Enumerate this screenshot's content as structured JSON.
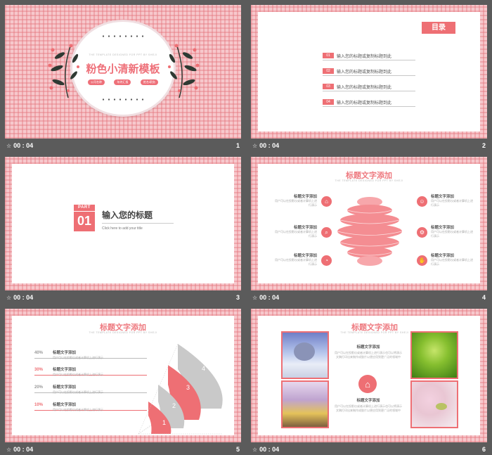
{
  "slides": [
    {
      "index": 1,
      "time": "00 : 04",
      "num": "1",
      "subtitle": "THE TEMPLATE DESIGNED FOR PPT BY SHEJI",
      "title": "粉色小清新模板",
      "tags": [
        "公司名称",
        "年终汇报",
        "姓名/职务"
      ]
    },
    {
      "index": 2,
      "time": "00 : 04",
      "num": "2",
      "heading": "目录",
      "items": [
        {
          "n": "01",
          "text": "输入您的标题或复制标题到此"
        },
        {
          "n": "02",
          "text": "输入您的标题或复制标题到此"
        },
        {
          "n": "03",
          "text": "输入您的标题或复制标题到此"
        },
        {
          "n": "04",
          "text": "输入您的标题或复制标题到此"
        }
      ]
    },
    {
      "index": 3,
      "time": "00 : 04",
      "num": "3",
      "part": "PART",
      "part_num": "01",
      "title": "输入您的标题",
      "subtitle": "Click here to add your title"
    },
    {
      "index": 4,
      "time": "00 : 04",
      "num": "4",
      "title": "标题文字添加",
      "subtitle": "THE TEMPLATE DESIGNED FOR PPT BY SHEJI",
      "blocks": [
        {
          "label": "标题文字添加",
          "desc": "用户可以在投影仪或者计算机上进行演示"
        },
        {
          "label": "标题文字添加",
          "desc": "用户可以在投影仪或者计算机上进行演示"
        },
        {
          "label": "标题文字添加",
          "desc": "用户可以在投影仪或者计算机上进行演示"
        },
        {
          "label": "标题文字添加",
          "desc": "用户可以在投影仪或者计算机上进行演示"
        },
        {
          "label": "标题文字添加",
          "desc": "用户可以在投影仪或者计算机上进行演示"
        },
        {
          "label": "标题文字添加",
          "desc": "用户可以在投影仪或者计算机上进行演示"
        }
      ],
      "icons": [
        "bank-icon",
        "search-icon",
        "pie-icon",
        "user-icon",
        "gear-icon",
        "hand-icon"
      ]
    },
    {
      "index": 5,
      "time": "00 : 04",
      "num": "5",
      "title": "标题文字添加",
      "subtitle": "THE TEMPLATE DESIGNED FOR PPT BY SHEJI",
      "rows": [
        {
          "pct": "40%",
          "label": "标题文字添加",
          "desc": "用户可以在投影仪或者计算机上进行演示"
        },
        {
          "pct": "30%",
          "label": "标题文字添加",
          "desc": "用户可以在投影仪或者计算机上进行演示"
        },
        {
          "pct": "20%",
          "label": "标题文字添加",
          "desc": "用户可以在投影仪或者计算机上进行演示"
        },
        {
          "pct": "10%",
          "label": "标题文字添加",
          "desc": "用户可以在投影仪或者计算机上进行演示"
        }
      ],
      "steps": [
        "1",
        "2",
        "3",
        "4"
      ]
    },
    {
      "index": 6,
      "time": "00 : 04",
      "num": "6",
      "title": "标题文字添加",
      "subtitle": "THE TEMPLATE DESIGNED FOR PPT BY SHEJI",
      "blocks": [
        {
          "label": "标题文字添加",
          "desc": "用户可以在投影仪或者计算机上进行演示也可以将演示文稿打印出来制作成胶片以便应用到更广泛的领域中"
        },
        {
          "label": "标题文字添加",
          "desc": "用户可以在投影仪或者计算机上进行演示也可以将演示文稿打印出来制作成胶片以便应用到更广泛的领域中"
        }
      ]
    }
  ],
  "colors": {
    "accent": "#ee6f74",
    "plaid": "#f7c8cc",
    "bg": "#5b5b5b"
  }
}
